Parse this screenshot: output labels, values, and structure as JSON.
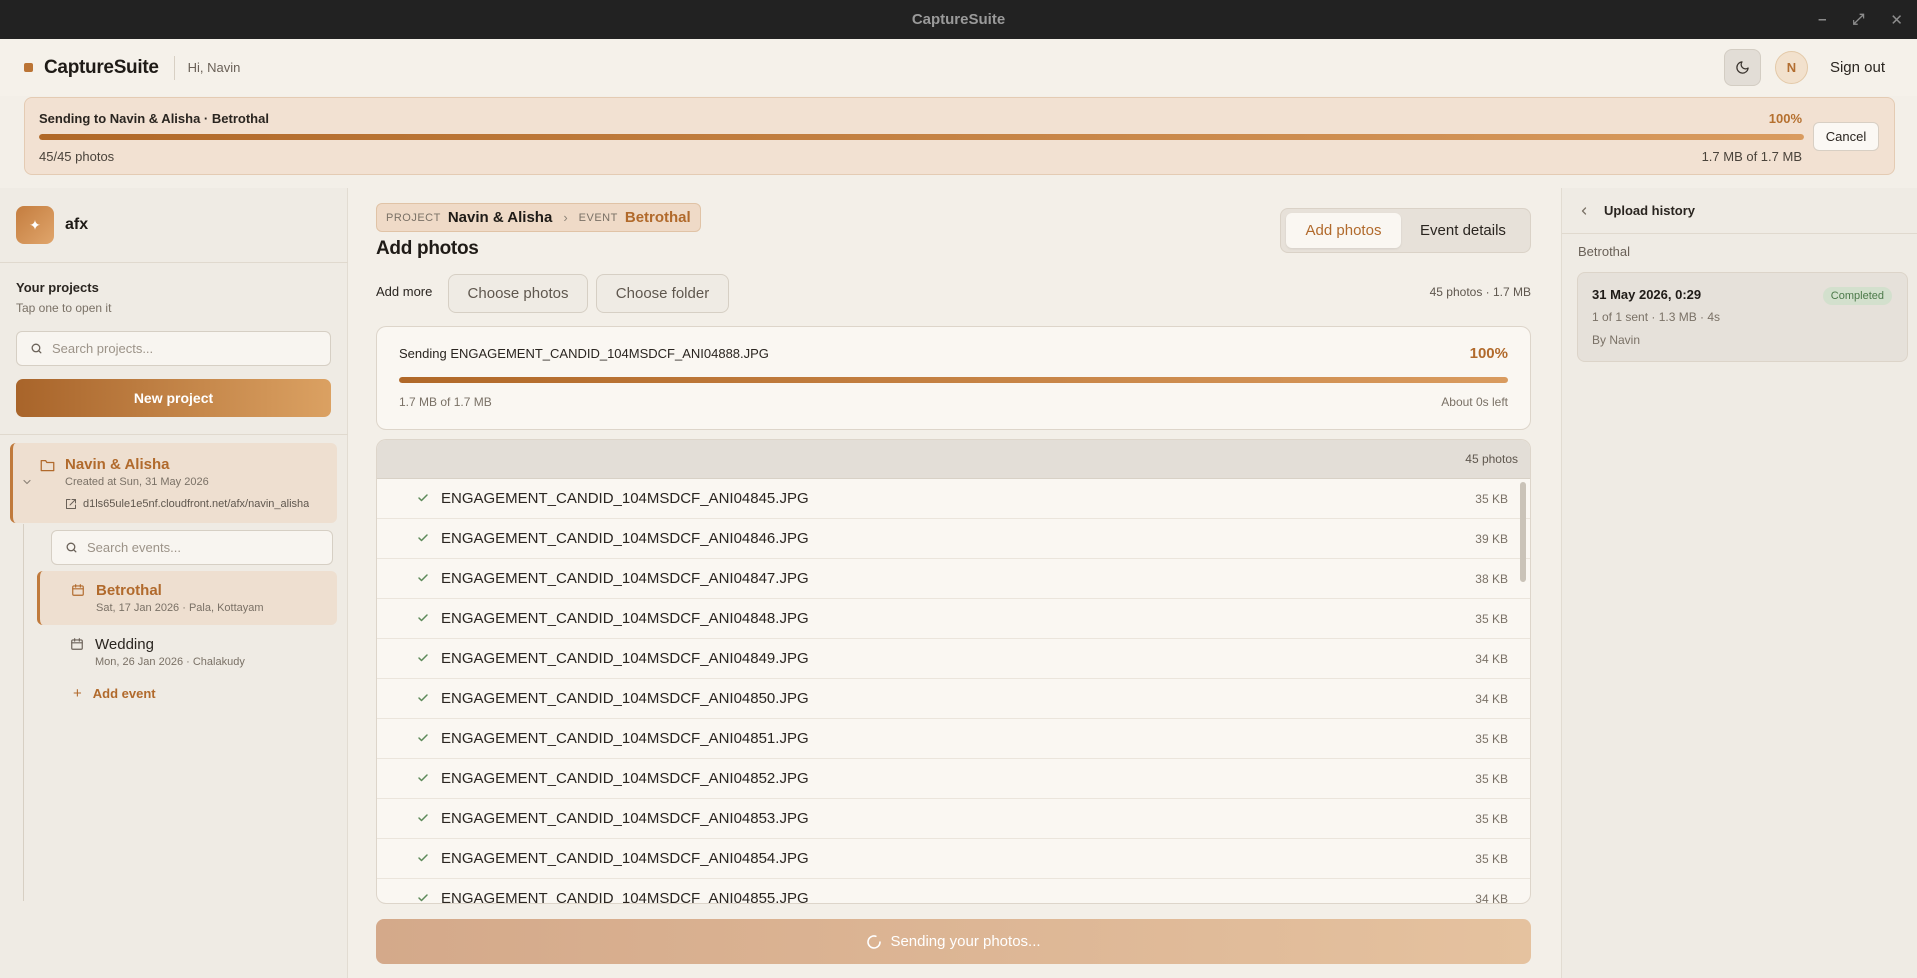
{
  "window": {
    "title": "CaptureSuite"
  },
  "header": {
    "brand": "CaptureSuite",
    "greeting": "Hi, Navin",
    "avatar_initial": "N",
    "signout_label": "Sign out"
  },
  "banner": {
    "title": "Sending to Navin & Alisha · Betrothal",
    "percent_label": "100%",
    "progress": 1.0,
    "count": "45/45 photos",
    "size": "1.7 MB of 1.7 MB",
    "cancel_label": "Cancel"
  },
  "sidebar": {
    "workspace_name": "afx",
    "heading": "Your projects",
    "subheading": "Tap one to open it",
    "search_placeholder": "Search projects...",
    "new_project_label": "New project",
    "project": {
      "name": "Navin & Alisha",
      "created": "Created at Sun, 31 May 2026",
      "link": "d1ls65ule1e5nf.cloudfront.net/afx/navin_alisha"
    },
    "event_search_placeholder": "Search events...",
    "events": [
      {
        "name": "Betrothal",
        "meta": "Sat, 17 Jan 2026 · Pala, Kottayam"
      },
      {
        "name": "Wedding",
        "meta": "Mon, 26 Jan 2026 · Chalakudy"
      }
    ],
    "add_event_label": "Add event"
  },
  "main": {
    "breadcrumb": {
      "project_label": "PROJECT",
      "project": "Navin & Alisha",
      "event_label": "EVENT",
      "event": "Betrothal"
    },
    "title": "Add photos",
    "tabs": [
      {
        "label": "Add photos"
      },
      {
        "label": "Event details"
      }
    ],
    "add_more_label": "Add more",
    "choose_photos_label": "Choose photos",
    "choose_folder_label": "Choose folder",
    "totals": "45 photos · 1.7 MB",
    "current": {
      "file": "Sending ENGAGEMENT_CANDID_104MSDCF_ANI04888.JPG",
      "percent_label": "100%",
      "progress": 1.0,
      "size": "1.7 MB of 1.7 MB",
      "eta": "About 0s left"
    },
    "list_count": "45 photos",
    "files": [
      {
        "name": "ENGAGEMENT_CANDID_104MSDCF_ANI04845.JPG",
        "size": "35 KB"
      },
      {
        "name": "ENGAGEMENT_CANDID_104MSDCF_ANI04846.JPG",
        "size": "39 KB"
      },
      {
        "name": "ENGAGEMENT_CANDID_104MSDCF_ANI04847.JPG",
        "size": "38 KB"
      },
      {
        "name": "ENGAGEMENT_CANDID_104MSDCF_ANI04848.JPG",
        "size": "35 KB"
      },
      {
        "name": "ENGAGEMENT_CANDID_104MSDCF_ANI04849.JPG",
        "size": "34 KB"
      },
      {
        "name": "ENGAGEMENT_CANDID_104MSDCF_ANI04850.JPG",
        "size": "34 KB"
      },
      {
        "name": "ENGAGEMENT_CANDID_104MSDCF_ANI04851.JPG",
        "size": "35 KB"
      },
      {
        "name": "ENGAGEMENT_CANDID_104MSDCF_ANI04852.JPG",
        "size": "35 KB"
      },
      {
        "name": "ENGAGEMENT_CANDID_104MSDCF_ANI04853.JPG",
        "size": "35 KB"
      },
      {
        "name": "ENGAGEMENT_CANDID_104MSDCF_ANI04854.JPG",
        "size": "35 KB"
      },
      {
        "name": "ENGAGEMENT_CANDID_104MSDCF_ANI04855.JPG",
        "size": "34 KB"
      }
    ],
    "sending_label": "Sending your photos..."
  },
  "history": {
    "title": "Upload history",
    "event": "Betrothal",
    "entries": [
      {
        "date": "31 May 2026, 0:29",
        "status": "Completed",
        "meta": "1 of 1 sent · 1.3 MB · 4s",
        "by": "By Navin"
      }
    ]
  },
  "colors": {
    "accent": "#b16a2c",
    "accent_light": "#dba162",
    "success": "#4c7a4a",
    "titlebar": "#222222"
  }
}
